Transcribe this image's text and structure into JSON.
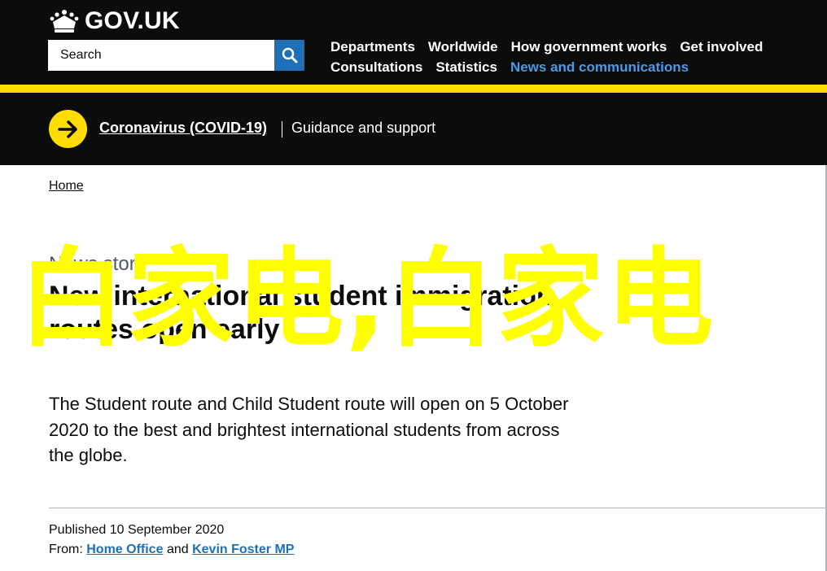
{
  "header": {
    "logo_text": "GOV.UK",
    "logo_icon": "crown-icon",
    "search": {
      "placeholder": "Search",
      "button_icon": "search-icon"
    },
    "nav": {
      "row1": [
        "Departments",
        "Worldwide",
        "How government works",
        "Get involved"
      ],
      "row2": [
        "Consultations",
        "Statistics",
        "News and communications"
      ],
      "active": "News and communications"
    }
  },
  "covid_banner": {
    "icon": "arrow-right-icon",
    "link": "Coronavirus (COVID-19)",
    "text": "Guidance and support"
  },
  "breadcrumb": {
    "home": "Home"
  },
  "article": {
    "caption": "News story",
    "title": "New international student immigration routes open early",
    "lede": "The Student route and Child Student route will open on 5 October 2020 to the best and brightest international students from across the globe."
  },
  "overlay_text": "白家电,白家电",
  "metadata": {
    "published_label": "Published",
    "published_date": "10 September 2020",
    "from_label": "From:",
    "from_org": "Home Office",
    "and": "and",
    "from_person": "Kevin Foster MP"
  },
  "colors": {
    "header_bg": "#0b0c0c",
    "accent_yellow": "#ffdd00",
    "link_blue": "#1d70b8",
    "active_nav": "#4c9ae6",
    "overlay": "#ffff00"
  }
}
